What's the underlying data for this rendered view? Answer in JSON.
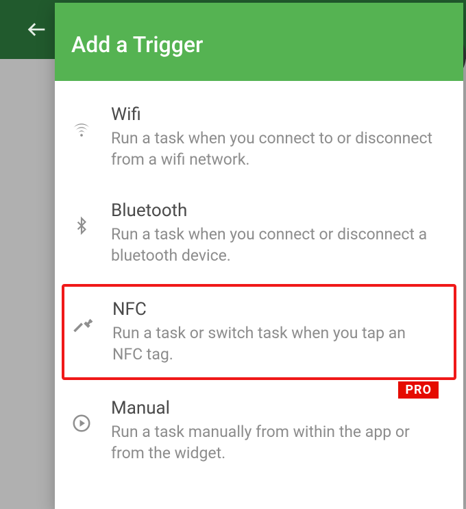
{
  "colors": {
    "primary": "#55b352",
    "primaryDark": "#215a2d",
    "highlight": "#f01919",
    "proBadge": "#e50b00"
  },
  "dialog": {
    "title": "Add a Trigger"
  },
  "triggers": [
    {
      "icon": "wifi-icon",
      "title": "Wifi",
      "description": "Run a task when you connect to or disconnect from a wifi network.",
      "highlighted": false,
      "pro": false
    },
    {
      "icon": "bluetooth-icon",
      "title": "Bluetooth",
      "description": "Run a task when you connect or disconnect a bluetooth device.",
      "highlighted": false,
      "pro": false
    },
    {
      "icon": "nfc-icon",
      "title": "NFC",
      "description": "Run a task or switch task when you tap an NFC tag.",
      "highlighted": true,
      "pro": false
    },
    {
      "icon": "play-circle-icon",
      "title": "Manual",
      "description": "Run a task manually from within the app or from the widget.",
      "highlighted": false,
      "pro": true,
      "proLabel": "PRO"
    }
  ]
}
